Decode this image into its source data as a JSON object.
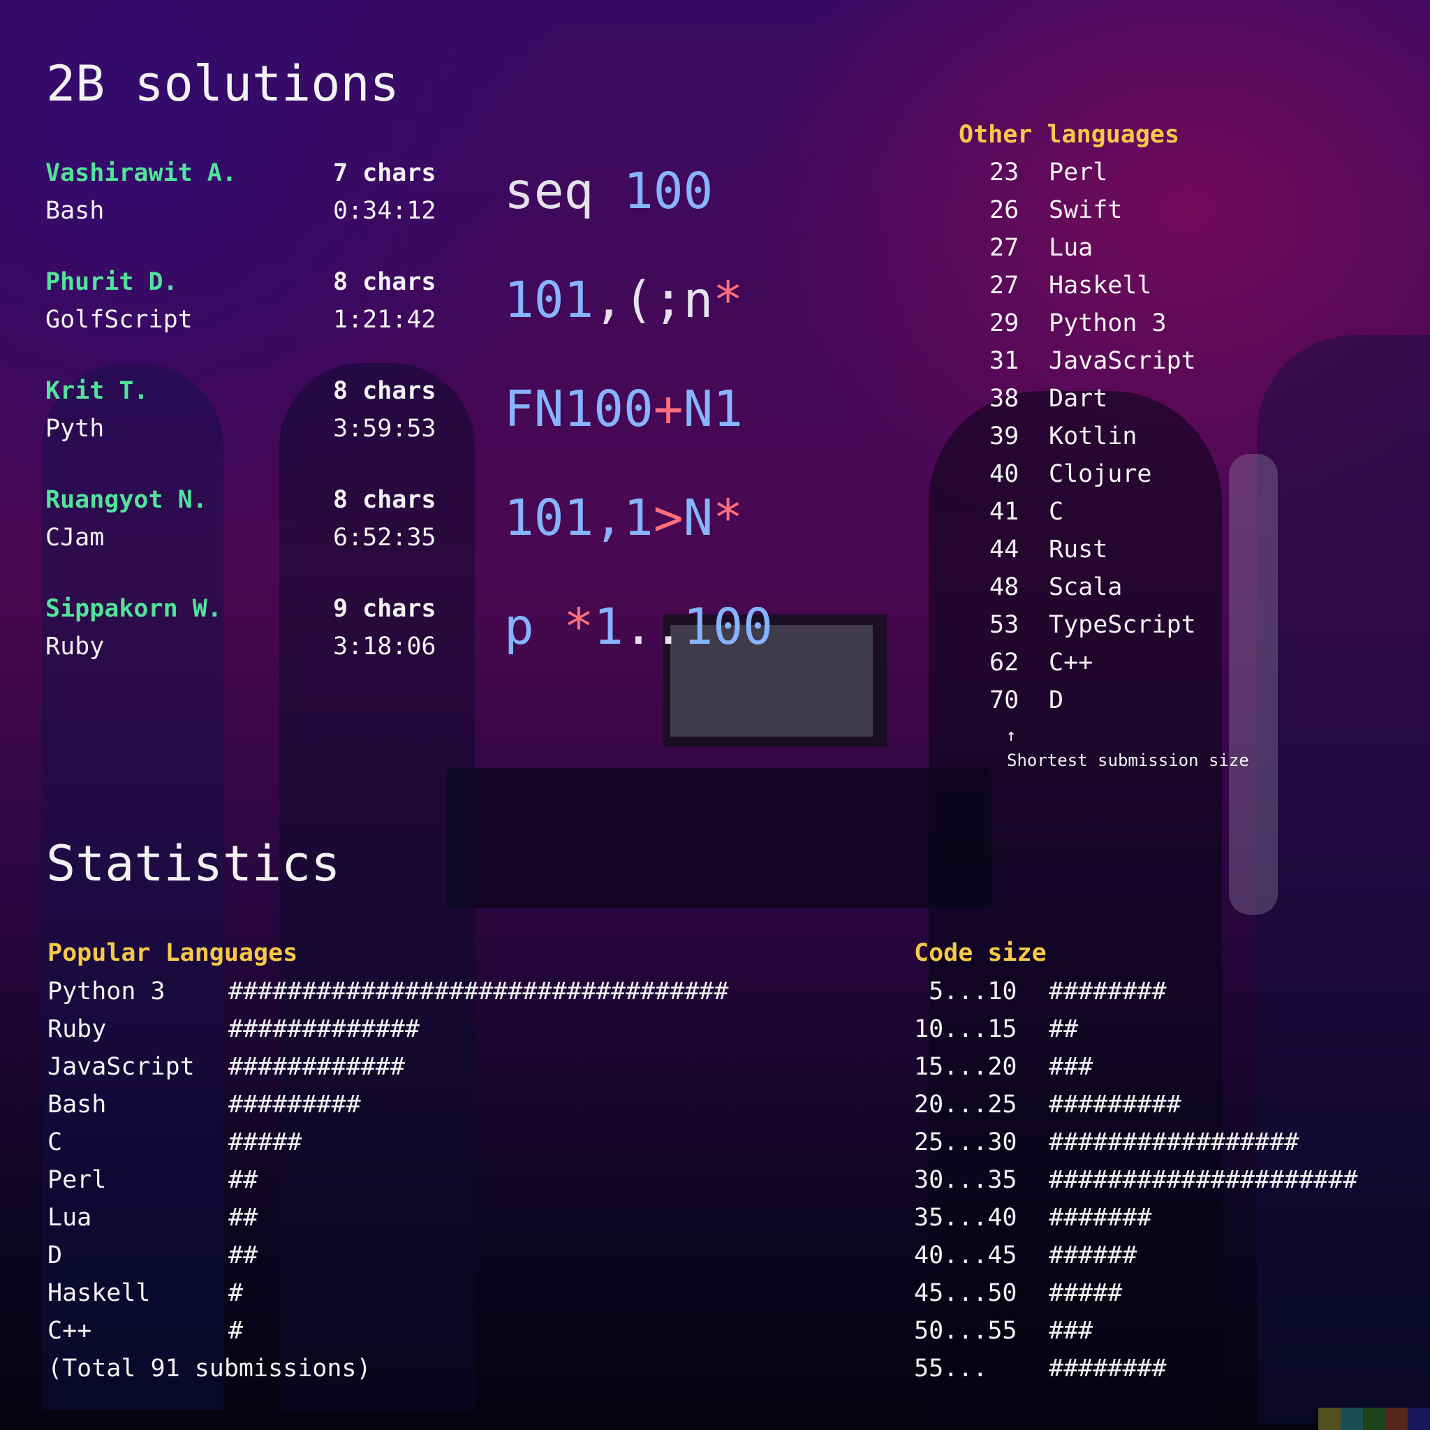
{
  "title": "2B solutions",
  "solvers": [
    {
      "name": "Vashirawit A.",
      "language": "Bash",
      "chars": "7 chars",
      "time": "0:34:12",
      "code": [
        {
          "t": "seq ",
          "c": "plain"
        },
        {
          "t": "100",
          "c": "blue"
        }
      ]
    },
    {
      "name": "Phurit D.",
      "language": "GolfScript",
      "chars": "8 chars",
      "time": "1:21:42",
      "code": [
        {
          "t": "101",
          "c": "blue"
        },
        {
          "t": ",(;n",
          "c": "plain"
        },
        {
          "t": "*",
          "c": "red"
        }
      ]
    },
    {
      "name": "Krit T.",
      "language": "Pyth",
      "chars": "8 chars",
      "time": "3:59:53",
      "code": [
        {
          "t": "FN100",
          "c": "blue"
        },
        {
          "t": "+",
          "c": "red"
        },
        {
          "t": "N1",
          "c": "blue"
        }
      ]
    },
    {
      "name": "Ruangyot N.",
      "language": "CJam",
      "chars": "8 chars",
      "time": "6:52:35",
      "code": [
        {
          "t": "101,1",
          "c": "blue"
        },
        {
          "t": ">",
          "c": "red"
        },
        {
          "t": "N",
          "c": "blue"
        },
        {
          "t": "*",
          "c": "red"
        }
      ]
    },
    {
      "name": "Sippakorn W.",
      "language": "Ruby",
      "chars": "9 chars",
      "time": "3:18:06",
      "code": [
        {
          "t": "p ",
          "c": "blue"
        },
        {
          "t": "*",
          "c": "red"
        },
        {
          "t": "1",
          "c": "blue"
        },
        {
          "t": "..",
          "c": "plain"
        },
        {
          "t": "100",
          "c": "blue"
        }
      ]
    }
  ],
  "other_languages": {
    "heading": "Other languages",
    "items": [
      {
        "size": "23",
        "lang": "Perl"
      },
      {
        "size": "26",
        "lang": "Swift"
      },
      {
        "size": "27",
        "lang": "Lua"
      },
      {
        "size": "27",
        "lang": "Haskell"
      },
      {
        "size": "29",
        "lang": "Python 3"
      },
      {
        "size": "31",
        "lang": "JavaScript"
      },
      {
        "size": "38",
        "lang": "Dart"
      },
      {
        "size": "39",
        "lang": "Kotlin"
      },
      {
        "size": "40",
        "lang": "Clojure"
      },
      {
        "size": "41",
        "lang": "C"
      },
      {
        "size": "44",
        "lang": "Rust"
      },
      {
        "size": "48",
        "lang": "Scala"
      },
      {
        "size": "53",
        "lang": "TypeScript"
      },
      {
        "size": "62",
        "lang": "C++"
      },
      {
        "size": "70",
        "lang": "D"
      }
    ],
    "arrow": "↑",
    "note": "Shortest submission size"
  },
  "statistics": {
    "heading": "Statistics",
    "popular": {
      "heading": "Popular Languages",
      "items": [
        {
          "lang": "Python 3",
          "count": 34
        },
        {
          "lang": "Ruby",
          "count": 13
        },
        {
          "lang": "JavaScript",
          "count": 12
        },
        {
          "lang": "Bash",
          "count": 9
        },
        {
          "lang": "C",
          "count": 5
        },
        {
          "lang": "Perl",
          "count": 2
        },
        {
          "lang": "Lua",
          "count": 2
        },
        {
          "lang": "D",
          "count": 2
        },
        {
          "lang": "Haskell",
          "count": 1
        },
        {
          "lang": "C++",
          "count": 1
        }
      ],
      "total": "(Total 91 submissions)"
    },
    "code_size": {
      "heading": "Code size",
      "items": [
        {
          "range": " 5...10",
          "count": 8
        },
        {
          "range": "10...15",
          "count": 2
        },
        {
          "range": "15...20",
          "count": 3
        },
        {
          "range": "20...25",
          "count": 9
        },
        {
          "range": "25...30",
          "count": 17
        },
        {
          "range": "30...35",
          "count": 21
        },
        {
          "range": "35...40",
          "count": 7
        },
        {
          "range": "40...45",
          "count": 6
        },
        {
          "range": "45...50",
          "count": 5
        },
        {
          "range": "50...55",
          "count": 3
        },
        {
          "range": "55...",
          "count": 8
        }
      ]
    }
  },
  "colors": {
    "plain": "#e6e2ea",
    "blue": "#86b4ff",
    "red": "#ff6f7d",
    "green": "#52e39a",
    "yellow": "#f7c948",
    "swatches": [
      "#545022",
      "#1c4f52",
      "#1e4219",
      "#55261a",
      "#17175a"
    ]
  }
}
